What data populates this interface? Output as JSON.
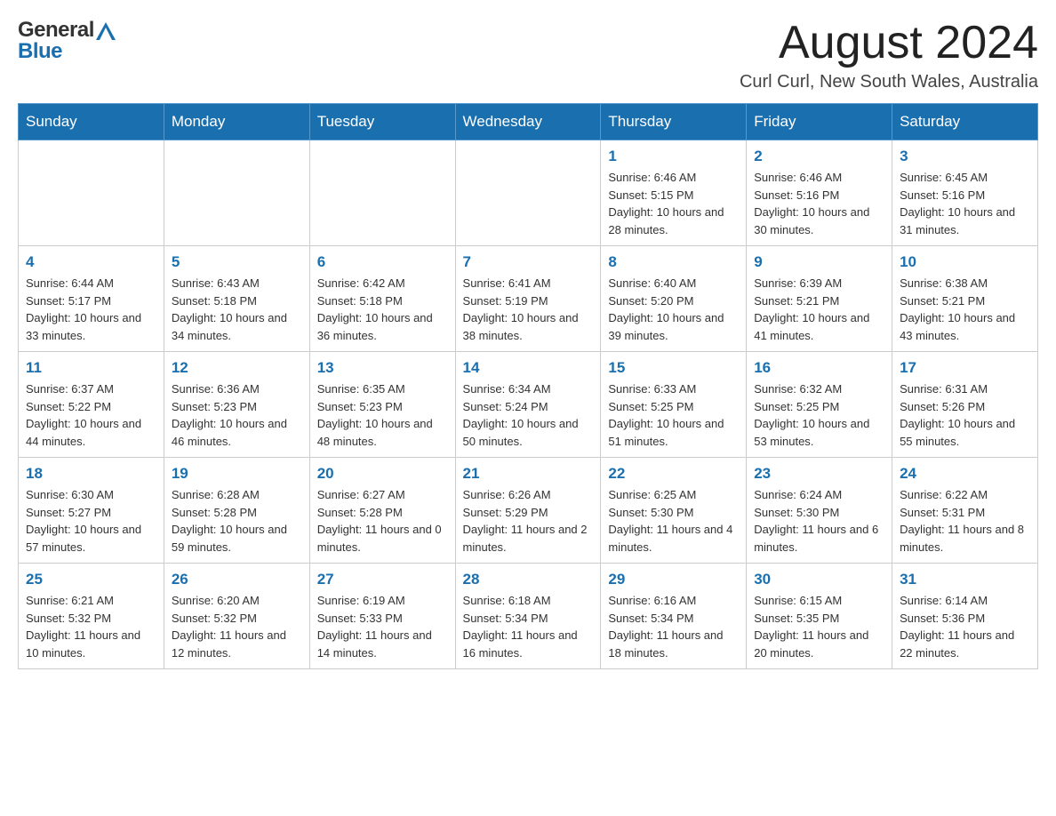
{
  "header": {
    "logo_general": "General",
    "logo_blue": "Blue",
    "title": "August 2024",
    "subtitle": "Curl Curl, New South Wales, Australia"
  },
  "calendar": {
    "days_of_week": [
      "Sunday",
      "Monday",
      "Tuesday",
      "Wednesday",
      "Thursday",
      "Friday",
      "Saturday"
    ],
    "weeks": [
      [
        {
          "day": "",
          "info": ""
        },
        {
          "day": "",
          "info": ""
        },
        {
          "day": "",
          "info": ""
        },
        {
          "day": "",
          "info": ""
        },
        {
          "day": "1",
          "info": "Sunrise: 6:46 AM\nSunset: 5:15 PM\nDaylight: 10 hours and 28 minutes."
        },
        {
          "day": "2",
          "info": "Sunrise: 6:46 AM\nSunset: 5:16 PM\nDaylight: 10 hours and 30 minutes."
        },
        {
          "day": "3",
          "info": "Sunrise: 6:45 AM\nSunset: 5:16 PM\nDaylight: 10 hours and 31 minutes."
        }
      ],
      [
        {
          "day": "4",
          "info": "Sunrise: 6:44 AM\nSunset: 5:17 PM\nDaylight: 10 hours and 33 minutes."
        },
        {
          "day": "5",
          "info": "Sunrise: 6:43 AM\nSunset: 5:18 PM\nDaylight: 10 hours and 34 minutes."
        },
        {
          "day": "6",
          "info": "Sunrise: 6:42 AM\nSunset: 5:18 PM\nDaylight: 10 hours and 36 minutes."
        },
        {
          "day": "7",
          "info": "Sunrise: 6:41 AM\nSunset: 5:19 PM\nDaylight: 10 hours and 38 minutes."
        },
        {
          "day": "8",
          "info": "Sunrise: 6:40 AM\nSunset: 5:20 PM\nDaylight: 10 hours and 39 minutes."
        },
        {
          "day": "9",
          "info": "Sunrise: 6:39 AM\nSunset: 5:21 PM\nDaylight: 10 hours and 41 minutes."
        },
        {
          "day": "10",
          "info": "Sunrise: 6:38 AM\nSunset: 5:21 PM\nDaylight: 10 hours and 43 minutes."
        }
      ],
      [
        {
          "day": "11",
          "info": "Sunrise: 6:37 AM\nSunset: 5:22 PM\nDaylight: 10 hours and 44 minutes."
        },
        {
          "day": "12",
          "info": "Sunrise: 6:36 AM\nSunset: 5:23 PM\nDaylight: 10 hours and 46 minutes."
        },
        {
          "day": "13",
          "info": "Sunrise: 6:35 AM\nSunset: 5:23 PM\nDaylight: 10 hours and 48 minutes."
        },
        {
          "day": "14",
          "info": "Sunrise: 6:34 AM\nSunset: 5:24 PM\nDaylight: 10 hours and 50 minutes."
        },
        {
          "day": "15",
          "info": "Sunrise: 6:33 AM\nSunset: 5:25 PM\nDaylight: 10 hours and 51 minutes."
        },
        {
          "day": "16",
          "info": "Sunrise: 6:32 AM\nSunset: 5:25 PM\nDaylight: 10 hours and 53 minutes."
        },
        {
          "day": "17",
          "info": "Sunrise: 6:31 AM\nSunset: 5:26 PM\nDaylight: 10 hours and 55 minutes."
        }
      ],
      [
        {
          "day": "18",
          "info": "Sunrise: 6:30 AM\nSunset: 5:27 PM\nDaylight: 10 hours and 57 minutes."
        },
        {
          "day": "19",
          "info": "Sunrise: 6:28 AM\nSunset: 5:28 PM\nDaylight: 10 hours and 59 minutes."
        },
        {
          "day": "20",
          "info": "Sunrise: 6:27 AM\nSunset: 5:28 PM\nDaylight: 11 hours and 0 minutes."
        },
        {
          "day": "21",
          "info": "Sunrise: 6:26 AM\nSunset: 5:29 PM\nDaylight: 11 hours and 2 minutes."
        },
        {
          "day": "22",
          "info": "Sunrise: 6:25 AM\nSunset: 5:30 PM\nDaylight: 11 hours and 4 minutes."
        },
        {
          "day": "23",
          "info": "Sunrise: 6:24 AM\nSunset: 5:30 PM\nDaylight: 11 hours and 6 minutes."
        },
        {
          "day": "24",
          "info": "Sunrise: 6:22 AM\nSunset: 5:31 PM\nDaylight: 11 hours and 8 minutes."
        }
      ],
      [
        {
          "day": "25",
          "info": "Sunrise: 6:21 AM\nSunset: 5:32 PM\nDaylight: 11 hours and 10 minutes."
        },
        {
          "day": "26",
          "info": "Sunrise: 6:20 AM\nSunset: 5:32 PM\nDaylight: 11 hours and 12 minutes."
        },
        {
          "day": "27",
          "info": "Sunrise: 6:19 AM\nSunset: 5:33 PM\nDaylight: 11 hours and 14 minutes."
        },
        {
          "day": "28",
          "info": "Sunrise: 6:18 AM\nSunset: 5:34 PM\nDaylight: 11 hours and 16 minutes."
        },
        {
          "day": "29",
          "info": "Sunrise: 6:16 AM\nSunset: 5:34 PM\nDaylight: 11 hours and 18 minutes."
        },
        {
          "day": "30",
          "info": "Sunrise: 6:15 AM\nSunset: 5:35 PM\nDaylight: 11 hours and 20 minutes."
        },
        {
          "day": "31",
          "info": "Sunrise: 6:14 AM\nSunset: 5:36 PM\nDaylight: 11 hours and 22 minutes."
        }
      ]
    ]
  }
}
